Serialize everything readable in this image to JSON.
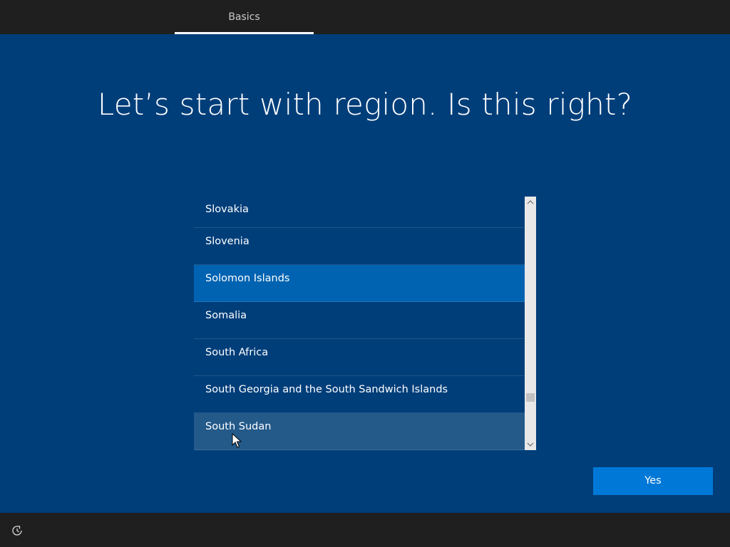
{
  "header": {
    "tab_label": "Basics"
  },
  "main": {
    "title": "Let’s start with region. Is this right?"
  },
  "region_list": {
    "items": [
      {
        "label": "Slovakia"
      },
      {
        "label": "Slovenia"
      },
      {
        "label": "Solomon Islands"
      },
      {
        "label": "Somalia"
      },
      {
        "label": "South Africa"
      },
      {
        "label": "South Georgia and the South Sandwich Islands"
      },
      {
        "label": "South Sudan"
      }
    ],
    "selected": "Solomon Islands",
    "hovered": "South Sudan"
  },
  "footer": {
    "yes_label": "Yes"
  },
  "colors": {
    "background": "#003e7a",
    "selected": "#0063b1",
    "button": "#0078d7",
    "bar": "#1f1f1f"
  },
  "icons": {
    "accessibility": "accessibility-icon",
    "scroll_up": "chevron-up-icon",
    "scroll_down": "chevron-down-icon",
    "cursor": "mouse-pointer-icon"
  }
}
